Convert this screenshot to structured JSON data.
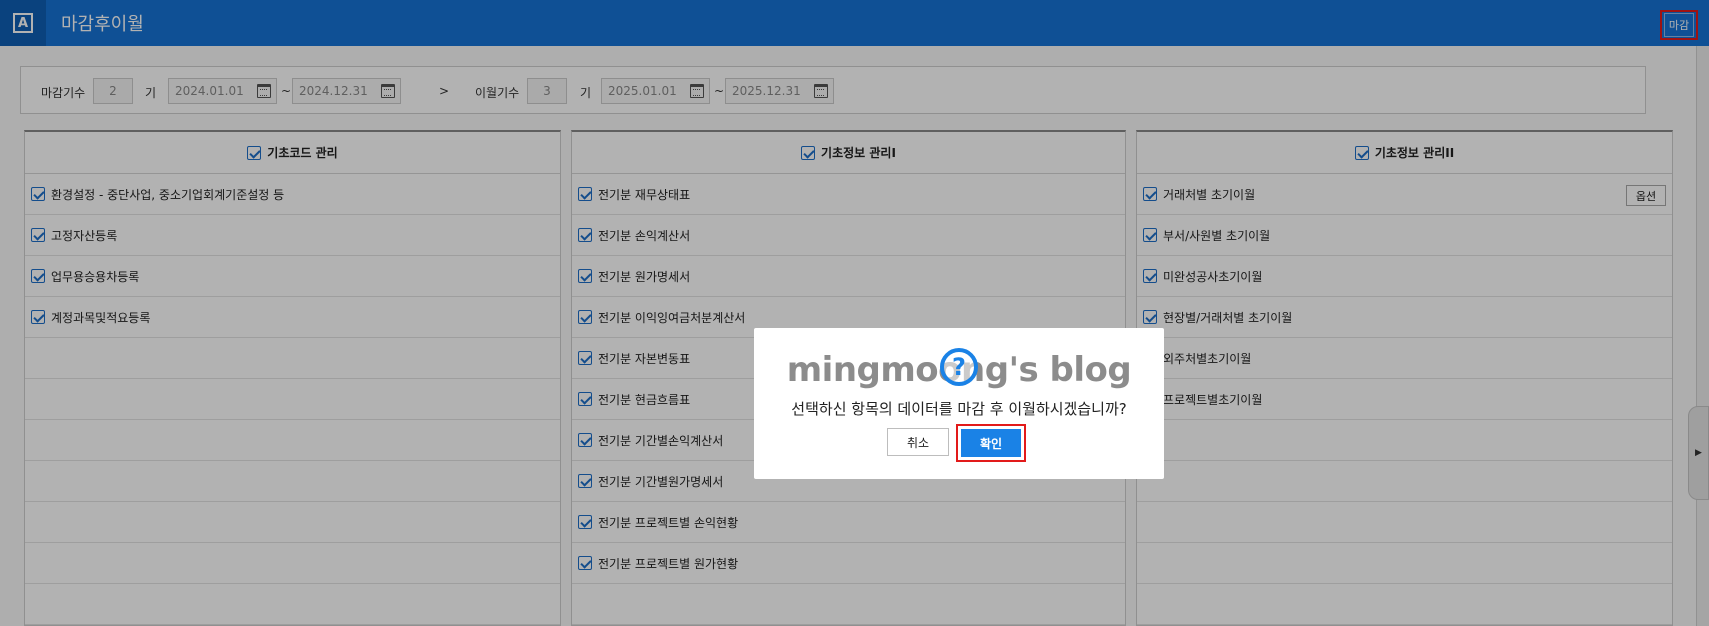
{
  "header": {
    "app_icon_letter": "A",
    "title": "마감후이월",
    "close_label": "마감"
  },
  "filter": {
    "close_period_label": "마감기수",
    "close_period_value": "2",
    "period_suffix": "기",
    "close_start": "2024.01.01",
    "close_end": "2024.12.31",
    "range_sep": "~",
    "arrow": ">",
    "carry_period_label": "이월기수",
    "carry_period_value": "3",
    "carry_start": "2025.01.01",
    "carry_end": "2025.12.31"
  },
  "panels": {
    "code_mgmt": {
      "title": "기초코드 관리",
      "items": [
        "환경설정 - 중단사업, 중소기업회계기준설정 등",
        "고정자산등록",
        "업무용승용차등록",
        "계정과목및적요등록"
      ]
    },
    "info_mgmt_1": {
      "title": "기초정보 관리I",
      "items": [
        "전기분 재무상태표",
        "전기분 손익계산서",
        "전기분 원가명세서",
        "전기분 이익잉여금처분계산서",
        "전기분 자본변동표",
        "전기분 현금흐름표",
        "전기분 기간별손익계산서",
        "전기분 기간별원가명세서",
        "전기분 프로젝트별 손익현황",
        "전기분 프로젝트별 원가현황"
      ]
    },
    "info_mgmt_2": {
      "title": "기초정보 관리II",
      "items": [
        "거래처별 초기이월",
        "부서/사원별 초기이월",
        "미완성공사초기이월",
        "현장별/거래처별 초기이월",
        "외주처별초기이월",
        "프로젝트별초기이월"
      ],
      "option_label": "옵션"
    }
  },
  "dialog": {
    "watermark": "mingmoong's blog",
    "help_glyph": "?",
    "message": "선택하신 항목의 데이터를 마감 후 이월하시겠습니까?",
    "cancel_label": "취소",
    "ok_label": "확인"
  },
  "side_tab_glyph": "▶",
  "colors": {
    "header_bg": "#1673d6",
    "accent": "#1a82e6",
    "highlight": "#e21a1a"
  }
}
